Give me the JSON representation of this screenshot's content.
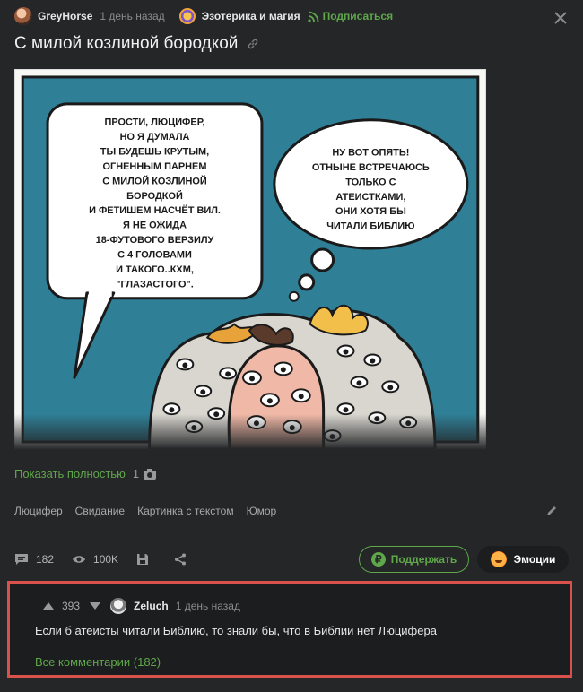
{
  "post": {
    "author": "GreyHorse",
    "time": "1 день назад",
    "community": "Эзотерика и магия",
    "subscribe": "Подписаться",
    "title": "С милой козлиной бородкой"
  },
  "image": {
    "bubble_left": [
      "ПРОСТИ, ЛЮЦИФЕР,",
      "НО Я ДУМАЛА",
      "ТЫ БУДЕШЬ КРУТЫМ,",
      "ОГНЕННЫМ ПАРНЕМ",
      "С МИЛОЙ КОЗЛИНОЙ",
      "БОРОДКОЙ",
      "И ФЕТИШЕМ НАСЧЁТ ВИЛ.",
      "Я НЕ ОЖИДА",
      "18-ФУТОВОГО ВЕРЗИЛУ",
      "С 4 ГОЛОВАМИ",
      "И ТАКОГО..КХМ,",
      "\"ГЛАЗАСТОГО\"."
    ],
    "bubble_right": [
      "НУ ВОТ ОПЯТЬ!",
      "ОТНЫНЕ ВСТРЕЧАЮСЬ",
      "ТОЛЬКО С",
      "АТЕИСТКАМИ,",
      "ОНИ ХОТЯ БЫ",
      "ЧИТАЛИ БИБЛИЮ"
    ]
  },
  "show_full": {
    "label": "Показать полностью",
    "count": "1"
  },
  "tags": [
    "Люцифер",
    "Свидание",
    "Картинка с текстом",
    "Юмор"
  ],
  "actions": {
    "comments": "182",
    "views": "100K",
    "support": "Поддержать",
    "emotions": "Эмоции"
  },
  "comment": {
    "score": "393",
    "author": "Zeluch",
    "time": "1 день назад",
    "text": "Если б атеисты читали Библию, то знали бы, что в Библии нет Люцифера",
    "all_comments": "Все комментарии (182)"
  },
  "colors": {
    "background": "#252628",
    "accent": "#5fa74a",
    "highlight_border": "#d9514b",
    "image_bg": "#2f7f96"
  }
}
